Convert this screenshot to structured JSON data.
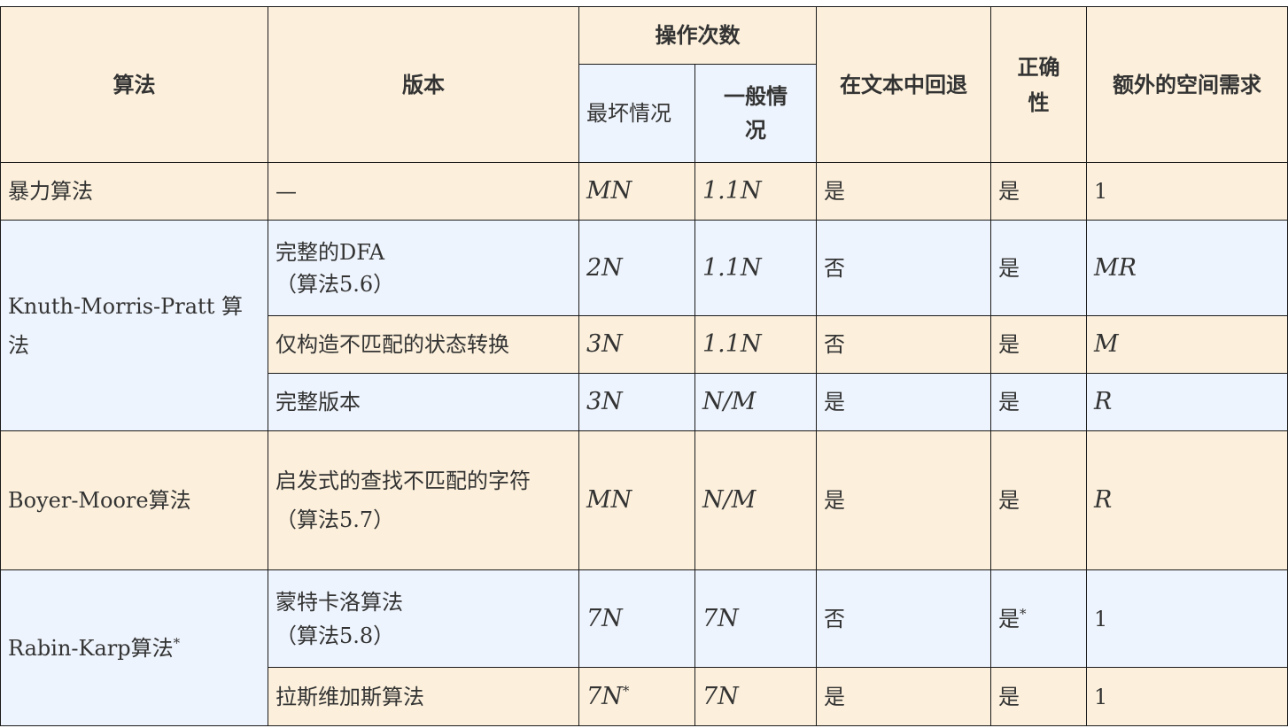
{
  "headers": {
    "algorithm": "算法",
    "version": "版本",
    "ops": "操作次数",
    "worst": "最坏情况",
    "typical": "一般情况",
    "backup": "在文本中回退",
    "correct": "正确性",
    "space": "额外的空间需求"
  },
  "rows": [
    {
      "algorithm": "暴力算法",
      "version": "—",
      "worst": "MN",
      "typical": "1.1N",
      "backup": "是",
      "correct": "是",
      "space": "1"
    },
    {
      "algorithm": "Knuth-Morris-Pratt 算法",
      "version_line1": "完整的DFA",
      "version_line2": "（算法5.6）",
      "worst": "2N",
      "typical": "1.1N",
      "backup": "否",
      "correct": "是",
      "space": "MR"
    },
    {
      "version": "仅构造不匹配的状态转换",
      "worst": "3N",
      "typical": "1.1N",
      "backup": "否",
      "correct": "是",
      "space": "M"
    },
    {
      "version": "完整版本",
      "worst": "3N",
      "typical": "N/M",
      "backup": "是",
      "correct": "是",
      "space": "R"
    },
    {
      "algorithm": "Boyer-Moore算法",
      "version_line1": "启发式的查找不匹配的字符",
      "version_line2": "（算法5.7）",
      "worst": "MN",
      "typical": "N/M",
      "backup": "是",
      "correct": "是",
      "space": "R"
    },
    {
      "algorithm": "Rabin-Karp算法",
      "algorithm_mark": "*",
      "version_line1": "蒙特卡洛算法",
      "version_line2": "（算法5.8）",
      "worst": "7N",
      "typical": "7N",
      "backup": "否",
      "correct": "是",
      "correct_mark": "*",
      "space": "1"
    },
    {
      "version": "拉斯维加斯算法",
      "worst": "7N",
      "worst_mark": "*",
      "typical": "7N",
      "backup": "是",
      "correct": "是",
      "space": "1"
    }
  ],
  "colors": {
    "beige": "#fcf0dc",
    "blue": "#eef4fd",
    "border": "#1a1a1a"
  }
}
